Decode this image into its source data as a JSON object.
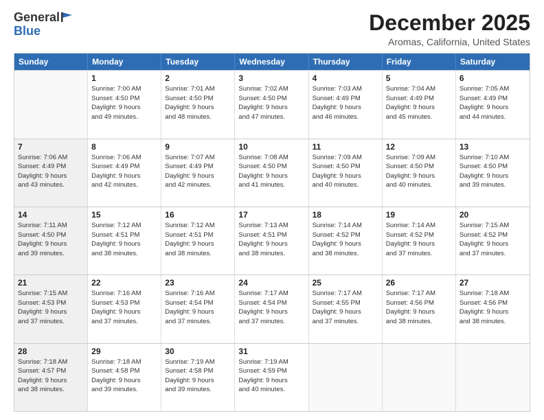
{
  "logo": {
    "line1": "General",
    "line2": "Blue"
  },
  "title": "December 2025",
  "subtitle": "Aromas, California, United States",
  "header_days": [
    "Sunday",
    "Monday",
    "Tuesday",
    "Wednesday",
    "Thursday",
    "Friday",
    "Saturday"
  ],
  "weeks": [
    [
      {
        "day": "",
        "text": "",
        "shaded": true
      },
      {
        "day": "1",
        "text": "Sunrise: 7:00 AM\nSunset: 4:50 PM\nDaylight: 9 hours\nand 49 minutes."
      },
      {
        "day": "2",
        "text": "Sunrise: 7:01 AM\nSunset: 4:50 PM\nDaylight: 9 hours\nand 48 minutes."
      },
      {
        "day": "3",
        "text": "Sunrise: 7:02 AM\nSunset: 4:50 PM\nDaylight: 9 hours\nand 47 minutes."
      },
      {
        "day": "4",
        "text": "Sunrise: 7:03 AM\nSunset: 4:49 PM\nDaylight: 9 hours\nand 46 minutes."
      },
      {
        "day": "5",
        "text": "Sunrise: 7:04 AM\nSunset: 4:49 PM\nDaylight: 9 hours\nand 45 minutes."
      },
      {
        "day": "6",
        "text": "Sunrise: 7:05 AM\nSunset: 4:49 PM\nDaylight: 9 hours\nand 44 minutes."
      }
    ],
    [
      {
        "day": "7",
        "text": "Sunrise: 7:06 AM\nSunset: 4:49 PM\nDaylight: 9 hours\nand 43 minutes.",
        "shaded": true
      },
      {
        "day": "8",
        "text": "Sunrise: 7:06 AM\nSunset: 4:49 PM\nDaylight: 9 hours\nand 42 minutes."
      },
      {
        "day": "9",
        "text": "Sunrise: 7:07 AM\nSunset: 4:49 PM\nDaylight: 9 hours\nand 42 minutes."
      },
      {
        "day": "10",
        "text": "Sunrise: 7:08 AM\nSunset: 4:50 PM\nDaylight: 9 hours\nand 41 minutes."
      },
      {
        "day": "11",
        "text": "Sunrise: 7:09 AM\nSunset: 4:50 PM\nDaylight: 9 hours\nand 40 minutes."
      },
      {
        "day": "12",
        "text": "Sunrise: 7:09 AM\nSunset: 4:50 PM\nDaylight: 9 hours\nand 40 minutes."
      },
      {
        "day": "13",
        "text": "Sunrise: 7:10 AM\nSunset: 4:50 PM\nDaylight: 9 hours\nand 39 minutes."
      }
    ],
    [
      {
        "day": "14",
        "text": "Sunrise: 7:11 AM\nSunset: 4:50 PM\nDaylight: 9 hours\nand 39 minutes.",
        "shaded": true
      },
      {
        "day": "15",
        "text": "Sunrise: 7:12 AM\nSunset: 4:51 PM\nDaylight: 9 hours\nand 38 minutes."
      },
      {
        "day": "16",
        "text": "Sunrise: 7:12 AM\nSunset: 4:51 PM\nDaylight: 9 hours\nand 38 minutes."
      },
      {
        "day": "17",
        "text": "Sunrise: 7:13 AM\nSunset: 4:51 PM\nDaylight: 9 hours\nand 38 minutes."
      },
      {
        "day": "18",
        "text": "Sunrise: 7:14 AM\nSunset: 4:52 PM\nDaylight: 9 hours\nand 38 minutes."
      },
      {
        "day": "19",
        "text": "Sunrise: 7:14 AM\nSunset: 4:52 PM\nDaylight: 9 hours\nand 37 minutes."
      },
      {
        "day": "20",
        "text": "Sunrise: 7:15 AM\nSunset: 4:52 PM\nDaylight: 9 hours\nand 37 minutes."
      }
    ],
    [
      {
        "day": "21",
        "text": "Sunrise: 7:15 AM\nSunset: 4:53 PM\nDaylight: 9 hours\nand 37 minutes.",
        "shaded": true
      },
      {
        "day": "22",
        "text": "Sunrise: 7:16 AM\nSunset: 4:53 PM\nDaylight: 9 hours\nand 37 minutes."
      },
      {
        "day": "23",
        "text": "Sunrise: 7:16 AM\nSunset: 4:54 PM\nDaylight: 9 hours\nand 37 minutes."
      },
      {
        "day": "24",
        "text": "Sunrise: 7:17 AM\nSunset: 4:54 PM\nDaylight: 9 hours\nand 37 minutes."
      },
      {
        "day": "25",
        "text": "Sunrise: 7:17 AM\nSunset: 4:55 PM\nDaylight: 9 hours\nand 37 minutes."
      },
      {
        "day": "26",
        "text": "Sunrise: 7:17 AM\nSunset: 4:56 PM\nDaylight: 9 hours\nand 38 minutes."
      },
      {
        "day": "27",
        "text": "Sunrise: 7:18 AM\nSunset: 4:56 PM\nDaylight: 9 hours\nand 38 minutes."
      }
    ],
    [
      {
        "day": "28",
        "text": "Sunrise: 7:18 AM\nSunset: 4:57 PM\nDaylight: 9 hours\nand 38 minutes.",
        "shaded": true
      },
      {
        "day": "29",
        "text": "Sunrise: 7:18 AM\nSunset: 4:58 PM\nDaylight: 9 hours\nand 39 minutes."
      },
      {
        "day": "30",
        "text": "Sunrise: 7:19 AM\nSunset: 4:58 PM\nDaylight: 9 hours\nand 39 minutes."
      },
      {
        "day": "31",
        "text": "Sunrise: 7:19 AM\nSunset: 4:59 PM\nDaylight: 9 hours\nand 40 minutes."
      },
      {
        "day": "",
        "text": "",
        "shaded": false,
        "empty": true
      },
      {
        "day": "",
        "text": "",
        "shaded": false,
        "empty": true
      },
      {
        "day": "",
        "text": "",
        "shaded": false,
        "empty": true
      }
    ]
  ]
}
